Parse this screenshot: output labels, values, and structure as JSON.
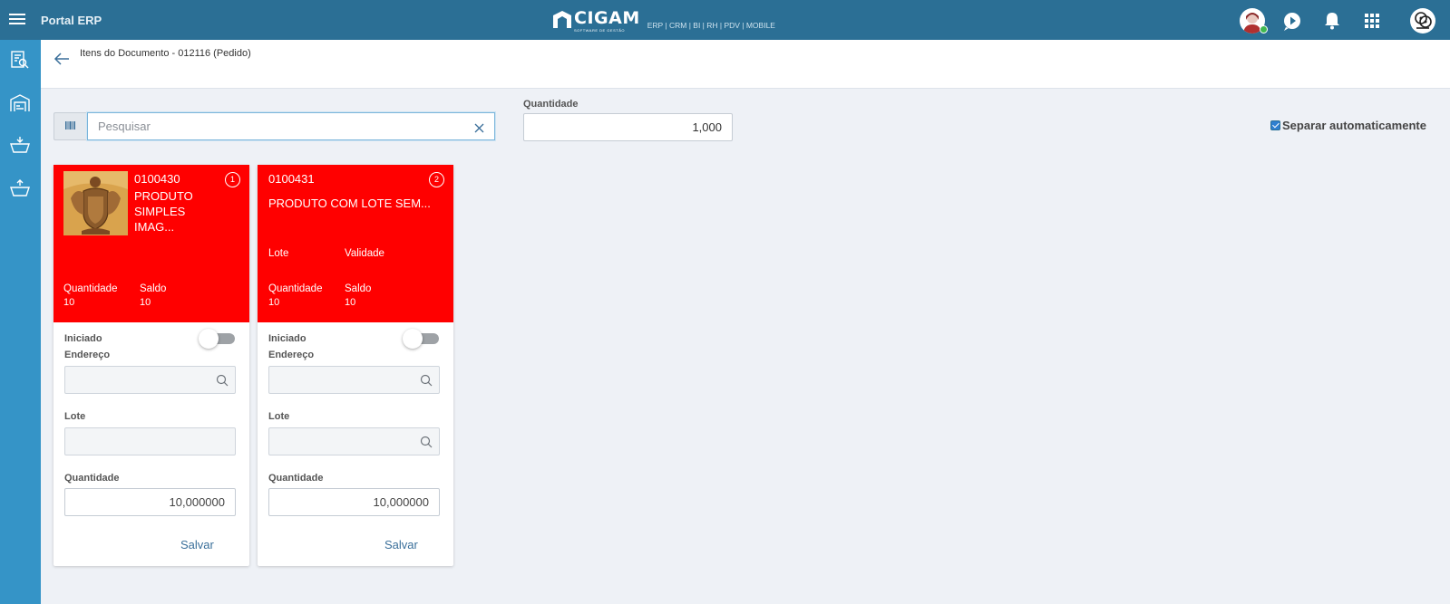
{
  "topbar": {
    "app_title": "Portal ERP",
    "logo_word": "CIGAM",
    "logo_sub": "SOFTWARE DE GESTÃO",
    "logo_modules": "ERP | CRM | BI | RH | PDV | MOBILE",
    "icons": [
      "menu-icon",
      "user-avatar",
      "play-icon",
      "bell-icon",
      "apps-grid-icon",
      "profile-avatar"
    ]
  },
  "sidebar": {
    "icons": [
      "search-report-icon",
      "warehouse-icon",
      "basket-down-icon",
      "basket-up-icon"
    ]
  },
  "header": {
    "title": "Itens do Documento - 012116 (Pedido)"
  },
  "search": {
    "placeholder": "Pesquisar",
    "value": ""
  },
  "quantity": {
    "label": "Quantidade",
    "value": "1,000"
  },
  "auto_separate": {
    "label": "Separar automaticamente",
    "checked": true
  },
  "colors": {
    "topbar": "#2b6f95",
    "sidebar": "#3594c7",
    "card_header": "#ff0000"
  },
  "cards": [
    {
      "index": "1",
      "code": "0100430",
      "name": "PRODUTO SIMPLES IMAG...",
      "has_image": true,
      "quantity_label": "Quantidade",
      "quantity": "10",
      "balance_label": "Saldo",
      "balance": "10",
      "started_label": "Iniciado",
      "started": false,
      "address_label": "Endereço",
      "lot_label": "Lote",
      "qty_label": "Quantidade",
      "qty_value": "10,000000",
      "save_label": "Salvar"
    },
    {
      "index": "2",
      "code": "0100431",
      "name": "PRODUTO COM LOTE SEM...",
      "has_image": false,
      "lot_header_label": "Lote",
      "validity_label": "Validade",
      "quantity_label": "Quantidade",
      "quantity": "10",
      "balance_label": "Saldo",
      "balance": "10",
      "started_label": "Iniciado",
      "started": false,
      "address_label": "Endereço",
      "lot_label": "Lote",
      "qty_label": "Quantidade",
      "qty_value": "10,000000",
      "save_label": "Salvar"
    }
  ]
}
